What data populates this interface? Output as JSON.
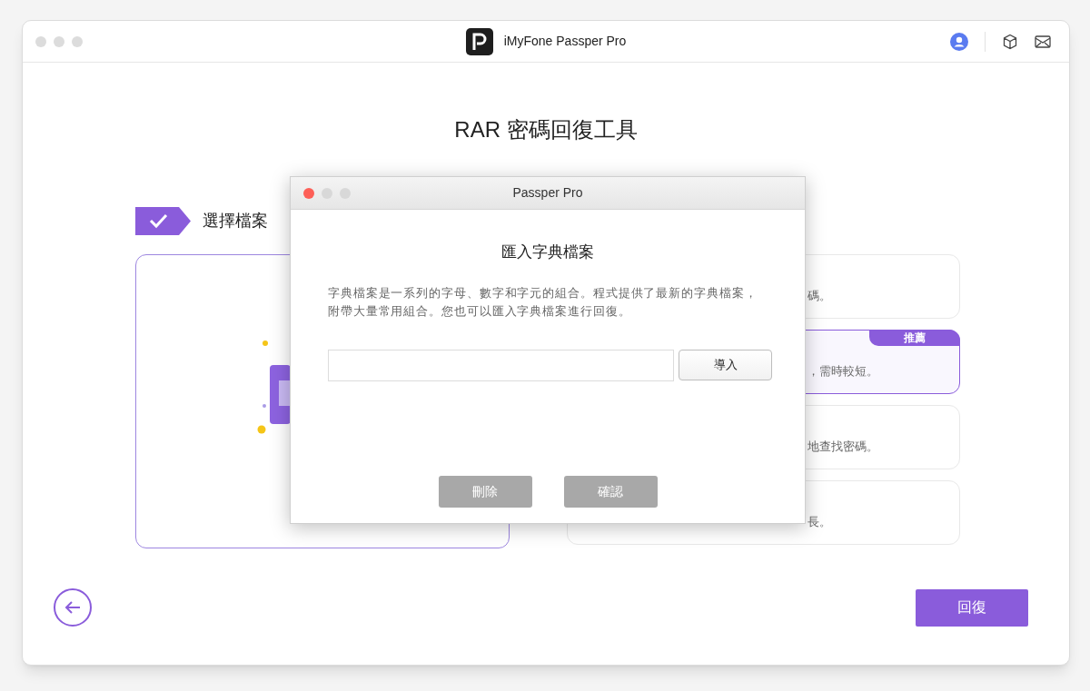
{
  "window": {
    "title": "iMyFone Passper Pro"
  },
  "page_title": "RAR 密碼回復工具",
  "step": {
    "label": "選擇檔案",
    "done": true
  },
  "attack_options": [
    {
      "text": "碼。",
      "selected": false
    },
    {
      "text": "，需時較短。",
      "selected": true,
      "badge": "推薦"
    },
    {
      "text": "地查找密碼。",
      "selected": false
    },
    {
      "text": "長。",
      "selected": false
    }
  ],
  "dialog": {
    "title": "Passper Pro",
    "heading": "匯入字典檔案",
    "description": "字典檔案是一系列的字母、數字和字元的組合。程式提供了最新的字典檔案，附帶大量常用組合。您也可以匯入字典檔案進行回復。",
    "import_button": "導入",
    "buttons": [
      {
        "label": "刪除",
        "disabled": true
      },
      {
        "label": "確認",
        "disabled": true
      }
    ]
  },
  "recover_button": "回復"
}
